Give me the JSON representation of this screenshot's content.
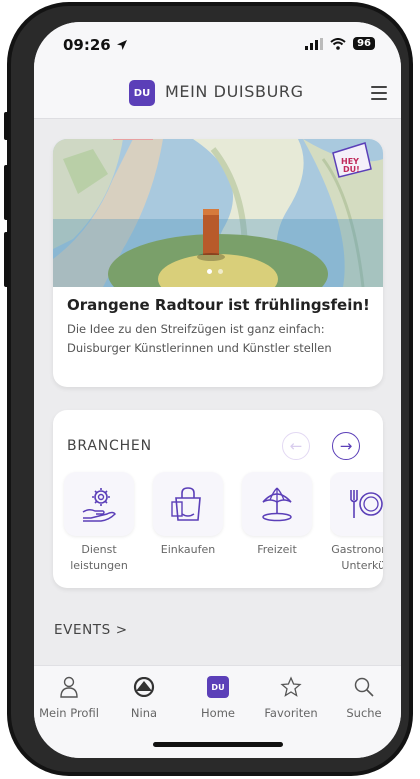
{
  "status_bar": {
    "time": "09:26",
    "battery": "96"
  },
  "app_bar": {
    "logo_text": "DU",
    "title": "MEIN DUISBURG"
  },
  "hero": {
    "badge_text": "HEY DU!",
    "title": "Orangene Radtour ist frühlingsfein!",
    "description": "Die Idee zu den Streifzügen ist ganz einfach: Duisburger Künstlerinnen und Künstler stellen",
    "slide_count": 2,
    "active_slide": 1
  },
  "branchen": {
    "title": "BRANCHEN",
    "prev_label": "←",
    "next_label": "→",
    "categories": [
      {
        "icon": "service-hand-gear-icon",
        "label": "Dienst\nleistungen"
      },
      {
        "icon": "shopping-bag-icon",
        "label": "Einkaufen"
      },
      {
        "icon": "beach-umbrella-icon",
        "label": "Freizeit"
      },
      {
        "icon": "plate-cutlery-icon",
        "label": "Gastronom\nUnterkün"
      }
    ]
  },
  "events": {
    "label": "EVENTS >"
  },
  "tabbar": {
    "tabs": [
      {
        "icon": "person-icon",
        "label": "Mein Profil"
      },
      {
        "icon": "nina-icon",
        "label": "Nina"
      },
      {
        "icon": "du-logo-icon",
        "label": "Home",
        "logo_text": "DU"
      },
      {
        "icon": "star-icon",
        "label": "Favoriten"
      },
      {
        "icon": "search-icon",
        "label": "Suche"
      }
    ]
  },
  "colors": {
    "accent": "#5b3fb8",
    "background": "#ececee"
  }
}
